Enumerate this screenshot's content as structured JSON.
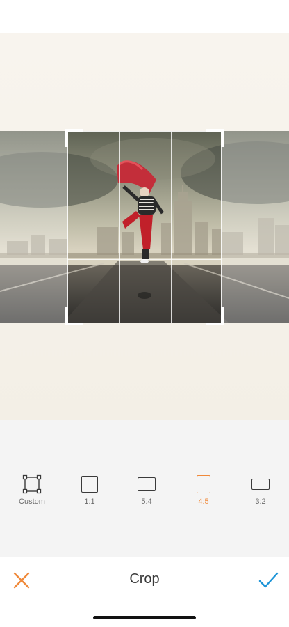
{
  "editor": {
    "title": "Crop",
    "cancel_icon": "close-icon",
    "confirm_icon": "checkmark-icon",
    "accent_color": "#f0893a"
  },
  "photo": {
    "description_icon": "photo-canvas"
  },
  "ratios": [
    {
      "label": "Custom",
      "icon": "custom-crop-icon",
      "active": false
    },
    {
      "label": "1:1",
      "icon": "square-ratio-icon",
      "active": false
    },
    {
      "label": "5:4",
      "icon": "landscape-5-4-icon",
      "active": false
    },
    {
      "label": "4:5",
      "icon": "portrait-4-5-icon",
      "active": true
    },
    {
      "label": "3:2",
      "icon": "landscape-3-2-icon",
      "active": false
    }
  ]
}
